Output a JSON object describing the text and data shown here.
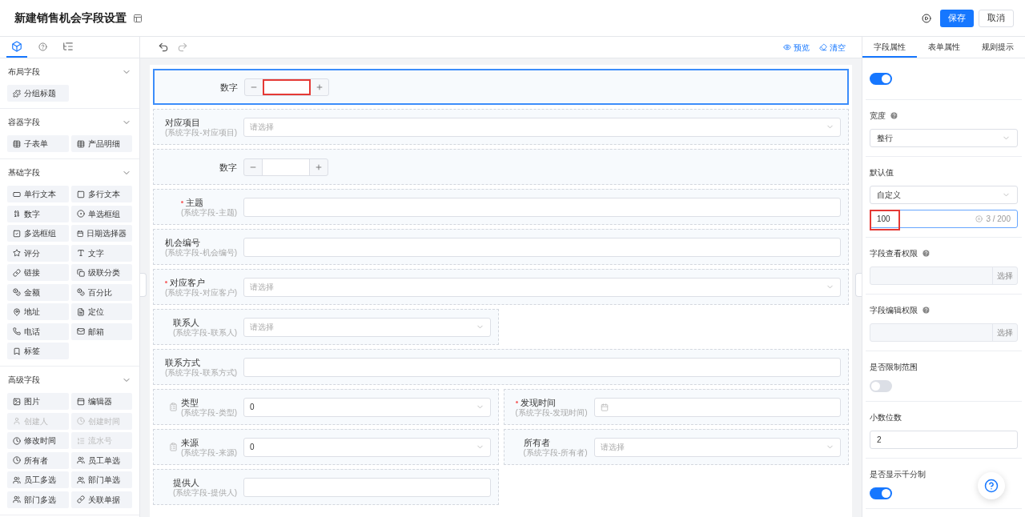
{
  "header": {
    "title": "新建销售机会字段设置",
    "actions": [
      {
        "label": "保存",
        "kind": "primary"
      },
      {
        "label": "取消",
        "kind": "default"
      }
    ]
  },
  "left_panel": {
    "tabs": [
      {
        "selected": true
      },
      {
        "selected": false
      },
      {
        "selected": false
      }
    ],
    "sections": [
      {
        "title": "布局字段",
        "expanded": true,
        "items": [
          {
            "label": "分组标题",
            "kind": "group",
            "disabled": false
          }
        ]
      },
      {
        "title": "容器字段",
        "expanded": true,
        "items": [
          {
            "label": "子表单",
            "kind": "subform",
            "disabled": false
          },
          {
            "label": "产品明细",
            "kind": "subform",
            "disabled": false
          }
        ]
      },
      {
        "title": "基础字段",
        "expanded": true,
        "items": [
          {
            "label": "单行文本",
            "kind": "single-line",
            "disabled": false
          },
          {
            "label": "多行文本",
            "kind": "multi-line",
            "disabled": false
          },
          {
            "label": "数字",
            "kind": "number",
            "disabled": false
          },
          {
            "label": "单选框组",
            "kind": "radio",
            "disabled": false
          },
          {
            "label": "多选框组",
            "kind": "checkbox",
            "disabled": false
          },
          {
            "label": "日期选择器",
            "kind": "date",
            "disabled": false
          },
          {
            "label": "评分",
            "kind": "rating",
            "disabled": false
          },
          {
            "label": "文字",
            "kind": "text",
            "disabled": false
          },
          {
            "label": "链接",
            "kind": "link",
            "disabled": false
          },
          {
            "label": "级联分类",
            "kind": "cascade",
            "disabled": false
          },
          {
            "label": "金额",
            "kind": "amount",
            "disabled": false
          },
          {
            "label": "百分比",
            "kind": "amount",
            "disabled": false
          },
          {
            "label": "地址",
            "kind": "address",
            "disabled": false
          },
          {
            "label": "定位",
            "kind": "location",
            "disabled": false
          },
          {
            "label": "电话",
            "kind": "phone",
            "disabled": false
          },
          {
            "label": "邮箱",
            "kind": "email",
            "disabled": false
          },
          {
            "label": "标签",
            "kind": "tag",
            "disabled": false
          }
        ]
      },
      {
        "title": "高级字段",
        "expanded": true,
        "items": [
          {
            "label": "图片",
            "kind": "image",
            "disabled": false
          },
          {
            "label": "编辑器",
            "kind": "editor",
            "disabled": false
          },
          {
            "label": "创建人",
            "kind": "person",
            "disabled": true
          },
          {
            "label": "创建时间",
            "kind": "time",
            "disabled": true
          },
          {
            "label": "修改时间",
            "kind": "time",
            "disabled": false
          },
          {
            "label": "流水号",
            "kind": "serial",
            "disabled": true
          },
          {
            "label": "所有者",
            "kind": "time",
            "disabled": false
          },
          {
            "label": "员工单选",
            "kind": "users",
            "disabled": false
          },
          {
            "label": "员工多选",
            "kind": "users",
            "disabled": false
          },
          {
            "label": "部门单选",
            "kind": "users",
            "disabled": false
          },
          {
            "label": "部门多选",
            "kind": "users",
            "disabled": false
          },
          {
            "label": "关联单据",
            "kind": "link",
            "disabled": false
          }
        ]
      }
    ]
  },
  "toolbar": {
    "actions": [
      {
        "label": "预览",
        "kind": "preview"
      },
      {
        "label": "清空",
        "kind": "clear"
      }
    ]
  },
  "canvas": {
    "fields": [
      {
        "label": "数字",
        "kind": "number",
        "full_width": true,
        "selected": true,
        "required": false,
        "highlighted": true
      },
      {
        "label": "对应项目",
        "sublabel": "(系统字段-对应项目)",
        "kind": "select",
        "placeholder": "请选择",
        "full_width": true,
        "selected": false,
        "required": false
      },
      {
        "label": "数字",
        "kind": "number",
        "full_width": true,
        "selected": false,
        "required": false,
        "highlighted": false
      },
      {
        "label": "主题",
        "sublabel": "(系统字段-主题)",
        "kind": "text",
        "full_width": true,
        "selected": false,
        "required": true
      },
      {
        "label": "机会编号",
        "sublabel": "(系统字段-机会编号)",
        "kind": "text",
        "full_width": true,
        "selected": false,
        "required": false
      },
      {
        "label": "对应客户",
        "sublabel": "(系统字段-对应客户)",
        "kind": "select",
        "placeholder": "请选择",
        "full_width": true,
        "selected": false,
        "required": true
      },
      {
        "label": "联系人",
        "sublabel": "(系统字段-联系人)",
        "kind": "select",
        "placeholder": "请选择",
        "full_width": false,
        "selected": false,
        "required": false
      },
      {
        "label": "联系方式",
        "sublabel": "(系统字段-联系方式)",
        "kind": "text",
        "full_width": true,
        "selected": false,
        "required": false
      },
      {
        "label": "类型",
        "sublabel": "(系统字段-类型)",
        "kind": "select",
        "value": "0",
        "full_width": false,
        "selected": false,
        "required": false,
        "prefix_icon": true
      },
      {
        "label": "发现时间",
        "sublabel": "(系统字段-发现时间)",
        "kind": "date",
        "full_width": false,
        "selected": false,
        "required": true
      },
      {
        "label": "来源",
        "sublabel": "(系统字段-来源)",
        "kind": "select",
        "value": "0",
        "full_width": false,
        "selected": false,
        "required": false,
        "prefix_icon": true
      },
      {
        "label": "所有者",
        "sublabel": "(系统字段-所有者)",
        "kind": "select",
        "placeholder": "请选择",
        "full_width": false,
        "selected": false,
        "required": false
      },
      {
        "label": "提供人",
        "sublabel": "(系统字段-提供人)",
        "kind": "text",
        "full_width": false,
        "selected": false,
        "required": false
      }
    ]
  },
  "right_panel": {
    "tabs": [
      {
        "label": "字段属性",
        "selected": true
      },
      {
        "label": "表单属性",
        "selected": false
      },
      {
        "label": "规则提示",
        "selected": false
      }
    ],
    "properties": [
      {
        "kind": "toggle",
        "on": true
      },
      {
        "kind": "select",
        "label": "宽度",
        "help": true,
        "value": "整行"
      },
      {
        "kind": "select-input",
        "label": "默认值",
        "help": false,
        "value": "自定义",
        "input_value": "100",
        "counter": "3 / 200",
        "highlighted": true
      },
      {
        "kind": "picker",
        "label": "字段查看权限",
        "help": true,
        "button": "选择"
      },
      {
        "kind": "picker",
        "label": "字段编辑权限",
        "help": true,
        "button": "选择"
      },
      {
        "kind": "toggle",
        "label": "是否限制范围",
        "help": false,
        "on": false
      },
      {
        "kind": "input",
        "label": "小数位数",
        "help": false,
        "value": "2"
      },
      {
        "kind": "toggle",
        "label": "是否显示千分制",
        "help": false,
        "on": true
      }
    ]
  }
}
